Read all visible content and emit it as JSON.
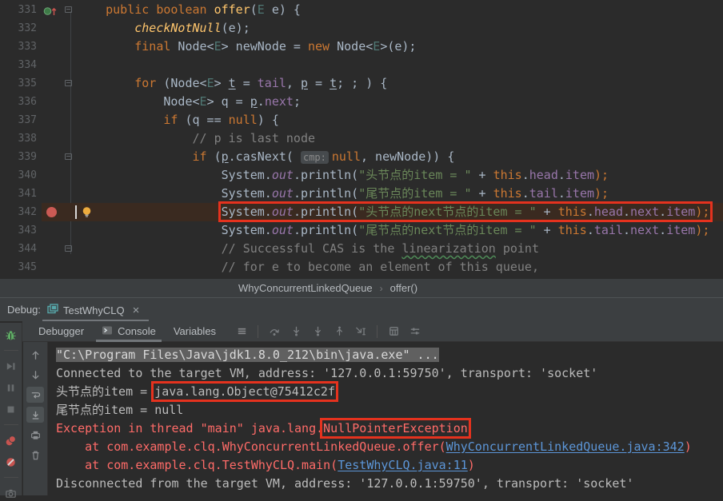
{
  "colors": {
    "annotation_red": "#e5321e",
    "error_red": "#ff6b68",
    "link_blue": "#5c96d8",
    "breakpoint_red": "#cb5a54",
    "current_line_bg": "#3a2a20",
    "keyword_orange": "#cc7832",
    "string_green": "#6a8759",
    "field_purple": "#9876aa"
  },
  "breadcrumb": {
    "class_name": "WhyConcurrentLinkedQueue",
    "method": "offer()",
    "chevron": "›"
  },
  "debug": {
    "label": "Debug:",
    "session_tab": "TestWhyCLQ",
    "close_glyph": "×",
    "tabs": {
      "debugger": "Debugger",
      "console": "Console",
      "variables": "Variables"
    },
    "selected_tab": "Console",
    "step_toolbar": [
      "settings-menu",
      "separator",
      "step-over",
      "step-into",
      "force-step-into",
      "step-out",
      "run-to-cursor",
      "separator",
      "evaluate-expression",
      "layout-settings"
    ],
    "left_strip": [
      "rerun-debug",
      "separator",
      "resume",
      "pause",
      "stop",
      "separator",
      "view-breakpoints",
      "mute-breakpoints",
      "separator",
      "thread-dump-camera"
    ],
    "console_strip": [
      "up-the-stack",
      "down-the-stack",
      "soft-wrap",
      "scroll-to-end",
      "print",
      "clear-all"
    ],
    "console_strip_selected": [
      "soft-wrap",
      "scroll-to-end"
    ]
  },
  "editor": {
    "lines": [
      {
        "num": 331,
        "ov": 1,
        "fold": 1,
        "tokens": [
          [
            "p",
            "    "
          ],
          [
            "k",
            "public"
          ],
          [
            "p",
            " "
          ],
          [
            "k",
            "boolean"
          ],
          [
            "p",
            " "
          ],
          [
            "m",
            "offer"
          ],
          [
            "p",
            "("
          ],
          [
            "tp",
            "E"
          ],
          [
            "p",
            " e) {"
          ]
        ]
      },
      {
        "num": 332,
        "tokens": [
          [
            "p",
            "        "
          ],
          [
            "mi",
            "checkNotNull"
          ],
          [
            "p",
            "(e);"
          ]
        ]
      },
      {
        "num": 333,
        "tokens": [
          [
            "p",
            "        "
          ],
          [
            "k",
            "final"
          ],
          [
            "p",
            " Node<"
          ],
          [
            "tp",
            "E"
          ],
          [
            "p",
            "> newNode = "
          ],
          [
            "k",
            "new"
          ],
          [
            "p",
            " Node<"
          ],
          [
            "tp",
            "E"
          ],
          [
            "p",
            ">(e);"
          ]
        ]
      },
      {
        "num": 334,
        "tokens": []
      },
      {
        "num": 335,
        "fold": 1,
        "tokens": [
          [
            "p",
            "        "
          ],
          [
            "k",
            "for"
          ],
          [
            "p",
            " (Node<"
          ],
          [
            "tp",
            "E"
          ],
          [
            "p",
            "> "
          ],
          [
            "u",
            "t"
          ],
          [
            "p",
            " = "
          ],
          [
            "f",
            "tail"
          ],
          [
            "p",
            ", "
          ],
          [
            "u",
            "p"
          ],
          [
            "p",
            " = "
          ],
          [
            "u",
            "t"
          ],
          [
            "p",
            "; ; ) {"
          ]
        ]
      },
      {
        "num": 336,
        "tokens": [
          [
            "p",
            "            Node<"
          ],
          [
            "tp",
            "E"
          ],
          [
            "p",
            "> q = "
          ],
          [
            "u",
            "p"
          ],
          [
            "p",
            "."
          ],
          [
            "f",
            "next"
          ],
          [
            "p",
            ";"
          ]
        ]
      },
      {
        "num": 337,
        "tokens": [
          [
            "p",
            "            "
          ],
          [
            "k",
            "if"
          ],
          [
            "p",
            " (q == "
          ],
          [
            "k",
            "null"
          ],
          [
            "p",
            ") {"
          ]
        ]
      },
      {
        "num": 338,
        "tokens": [
          [
            "p",
            "                "
          ],
          [
            "c",
            "// p is last node"
          ]
        ]
      },
      {
        "num": 339,
        "fold": 1,
        "tokens": [
          [
            "p",
            "                "
          ],
          [
            "k",
            "if"
          ],
          [
            "p",
            " ("
          ],
          [
            "u",
            "p"
          ],
          [
            "p",
            ".casNext( "
          ],
          [
            "h",
            "cmp:"
          ],
          [
            "k",
            "null"
          ],
          [
            "p",
            ", newNode)) {"
          ]
        ]
      },
      {
        "num": 340,
        "tokens": [
          [
            "p",
            "                    System."
          ],
          [
            "fi",
            "out"
          ],
          [
            "p",
            ".println("
          ],
          [
            "s",
            "\"头节点的item = \""
          ],
          [
            "p",
            " + "
          ],
          [
            "k",
            "this"
          ],
          [
            "p",
            "."
          ],
          [
            "f",
            "head"
          ],
          [
            "p",
            "."
          ],
          [
            "f",
            "item"
          ],
          [
            "k",
            ");"
          ]
        ]
      },
      {
        "num": 341,
        "tokens": [
          [
            "p",
            "                    System."
          ],
          [
            "fi",
            "out"
          ],
          [
            "p",
            ".println("
          ],
          [
            "s",
            "\"尾节点的item = \""
          ],
          [
            "p",
            " + "
          ],
          [
            "k",
            "this"
          ],
          [
            "p",
            "."
          ],
          [
            "f",
            "tail"
          ],
          [
            "p",
            "."
          ],
          [
            "f",
            "item"
          ],
          [
            "k",
            ");"
          ]
        ]
      },
      {
        "num": 342,
        "bp": 1,
        "cur": 1,
        "tokens": [
          [
            "p",
            "                    "
          ],
          [
            "p",
            "System.",
            "b"
          ],
          [
            "fi",
            "out",
            "b"
          ],
          [
            "p",
            ".println(",
            "b"
          ],
          [
            "s",
            "\"头节点的next节点的item = \"",
            "b"
          ],
          [
            "p",
            " + ",
            "b"
          ],
          [
            "k",
            "this",
            "b"
          ],
          [
            "p",
            ".",
            "b"
          ],
          [
            "f",
            "head",
            "b"
          ],
          [
            "p",
            ".",
            "b"
          ],
          [
            "f",
            "next",
            "b"
          ],
          [
            "p",
            ".",
            "b"
          ],
          [
            "f",
            "item",
            "b"
          ],
          [
            "k",
            ");",
            "b"
          ]
        ]
      },
      {
        "num": 343,
        "tokens": [
          [
            "p",
            "                    System."
          ],
          [
            "fi",
            "out"
          ],
          [
            "p",
            ".println("
          ],
          [
            "s",
            "\"尾节点的next节点的item = \""
          ],
          [
            "p",
            " + "
          ],
          [
            "k",
            "this"
          ],
          [
            "p",
            "."
          ],
          [
            "f",
            "tail"
          ],
          [
            "p",
            "."
          ],
          [
            "f",
            "next"
          ],
          [
            "p",
            "."
          ],
          [
            "f",
            "item"
          ],
          [
            "k",
            ");"
          ]
        ]
      },
      {
        "num": 344,
        "fold": 1,
        "tokens": [
          [
            "p",
            "                    "
          ],
          [
            "c",
            "// Successful CAS is the "
          ],
          [
            "cw",
            "linearization"
          ],
          [
            "c",
            " point"
          ]
        ]
      },
      {
        "num": 345,
        "tokens": [
          [
            "p",
            "                    "
          ],
          [
            "c",
            "// for e to become an element of this queue,"
          ]
        ]
      }
    ]
  },
  "console": {
    "lines": [
      {
        "segs": [
          [
            "hl",
            "\"C:\\Program Files\\Java\\jdk1.8.0_212\\bin\\java.exe\" ..."
          ]
        ]
      },
      {
        "segs": [
          [
            "p",
            "Connected to the target VM, address: '127.0.0.1:59750', transport: 'socket'"
          ]
        ]
      },
      {
        "segs": [
          [
            "p",
            "头节点的item = "
          ],
          [
            "p",
            "java.lang.Object@75412c2f",
            "b"
          ]
        ]
      },
      {
        "segs": [
          [
            "p",
            "尾节点的item = null"
          ]
        ]
      },
      {
        "segs": [
          [
            "e",
            "Exception in thread \"main\" java.lang."
          ],
          [
            "e",
            "NullPointerException",
            "b"
          ]
        ]
      },
      {
        "segs": [
          [
            "e",
            "    at com.example.clq.WhyConcurrentLinkedQueue.offer("
          ],
          [
            "l",
            "WhyConcurrentLinkedQueue.java:342"
          ],
          [
            "e",
            ")"
          ]
        ]
      },
      {
        "segs": [
          [
            "e",
            "    at com.example.clq.TestWhyCLQ.main("
          ],
          [
            "l",
            "TestWhyCLQ.java:11"
          ],
          [
            "e",
            ")"
          ]
        ]
      },
      {
        "segs": [
          [
            "p",
            "Disconnected from the target VM, address: '127.0.0.1:59750', transport: 'socket'"
          ]
        ]
      }
    ]
  }
}
